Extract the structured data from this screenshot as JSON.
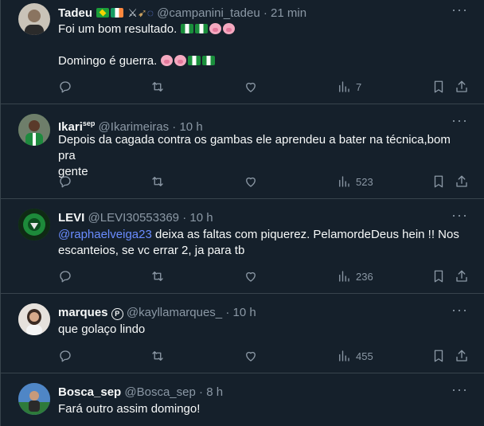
{
  "tweets": [
    {
      "name": "Tadeu",
      "handle": "@campanini_tadeu",
      "time": "21 min",
      "line1": "Foi um bom resultado.",
      "line2": "Domingo é guerra.",
      "views": "7",
      "avatar_color": "#c9c3b8"
    },
    {
      "name": "Ikari",
      "name_badge": "sep",
      "handle": "@Ikarimeiras",
      "time": "10 h",
      "line1": "Depois da cagada contra os gambas ele aprendeu a bater na técnica,bom pra",
      "line2": "gente",
      "views": "523",
      "avatar_color": "#2f7a3a"
    },
    {
      "name": "LEVI",
      "handle": "@LEVI30553369",
      "time": "10 h",
      "mention": "@raphaelveiga23",
      "line1": " deixa as faltas com piquerez. PelamordeDeus hein !! Nos",
      "line2": "escanteios, se vc errar 2, ja para tb",
      "views": "236",
      "avatar_color": "#1f6b2c"
    },
    {
      "name": "marques",
      "name_badge": "P",
      "handle": "@kayllamarques_",
      "time": "10 h",
      "line1": "que golaço lindo",
      "views": "455",
      "avatar_color": "#d8d2cc"
    },
    {
      "name": "Bosca_sep",
      "handle": "@Bosca_sep",
      "time": "8 h",
      "line1": "Fará outro assim domingo!",
      "avatar_color": "#3a6fb0"
    }
  ],
  "separator": "·",
  "icons": [
    "reply-icon",
    "retweet-icon",
    "like-icon",
    "views-icon",
    "bookmark-icon",
    "share-icon",
    "more-icon"
  ]
}
